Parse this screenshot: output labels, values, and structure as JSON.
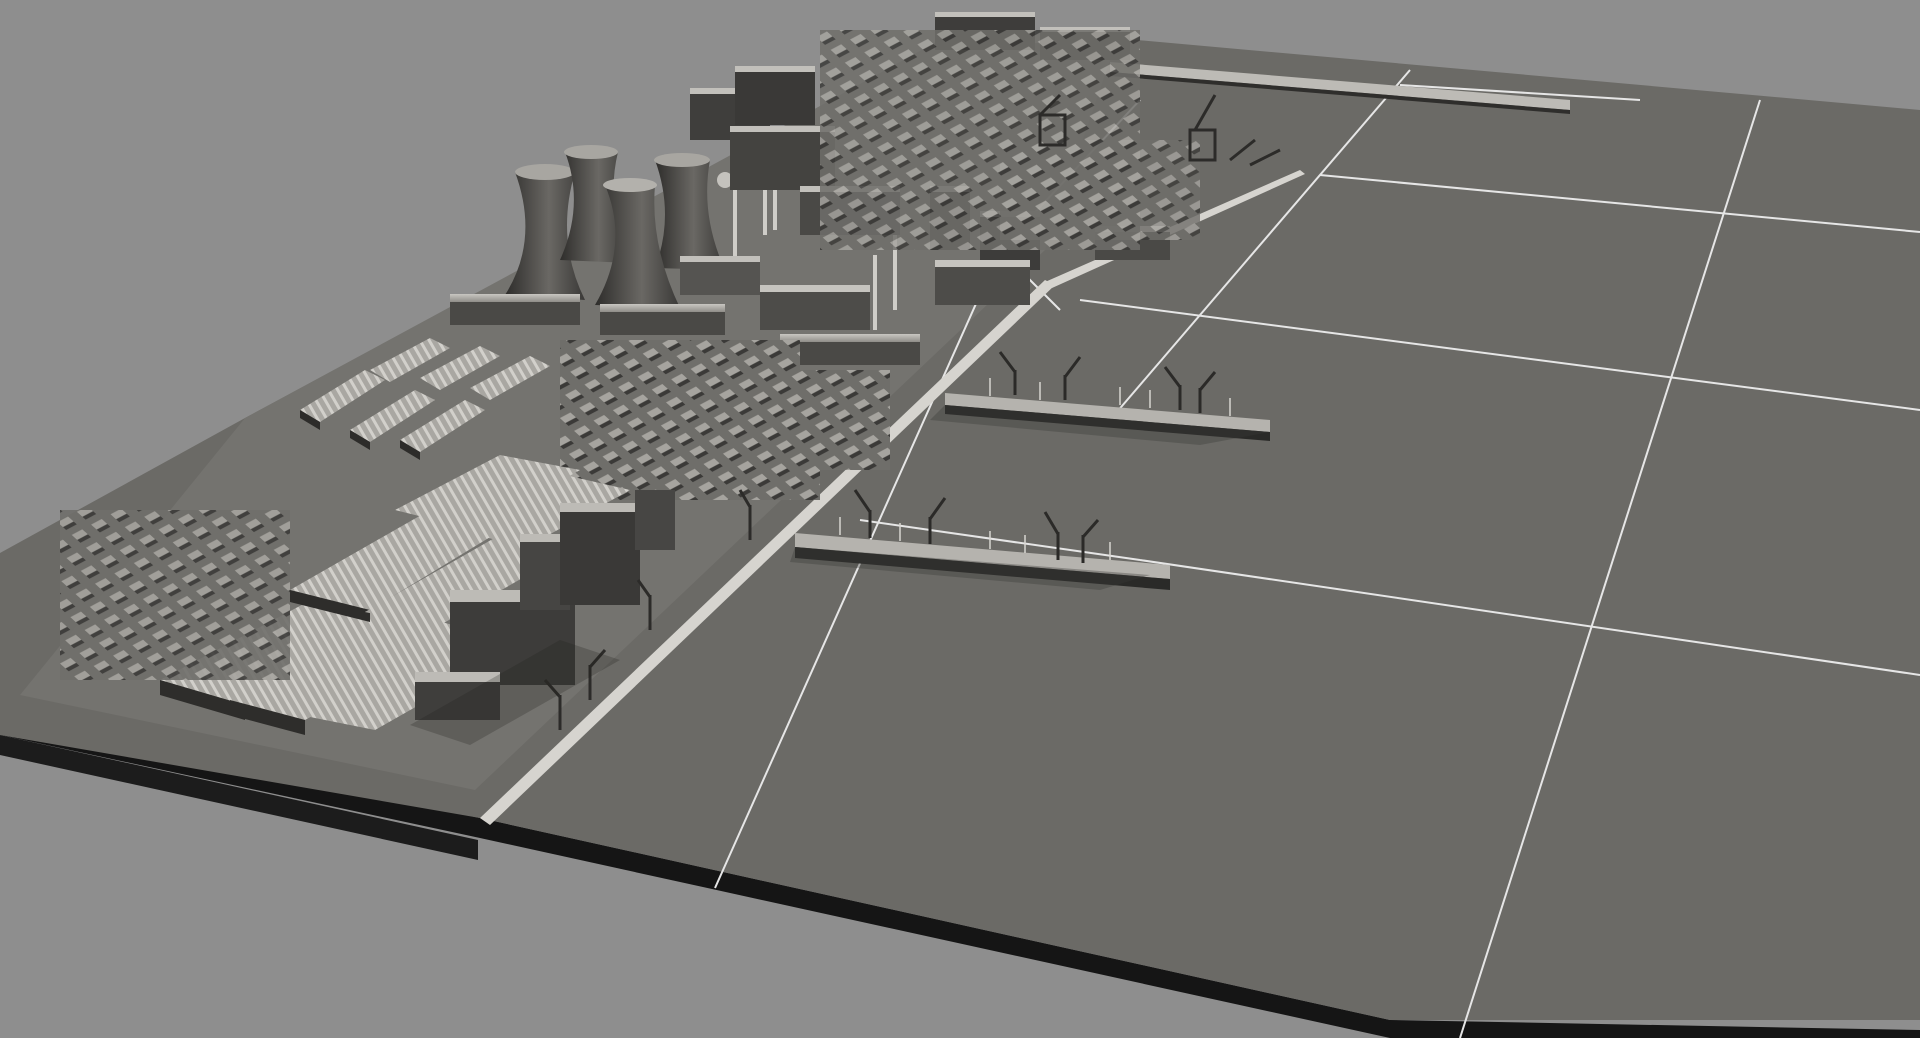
{
  "scene": {
    "subject": "3d-industrial-port-model",
    "render_style": "grayscale-clay",
    "colors": {
      "background": "#8e8e8e",
      "ground_top": "#6b6a66",
      "ground_side": "#1a1a1a",
      "grid_line": "#e8e8e8",
      "building_light": "#b9b7b2",
      "building_mid": "#8a8884",
      "building_dark": "#3e3d3b",
      "shadow": "#2a2a28"
    }
  }
}
